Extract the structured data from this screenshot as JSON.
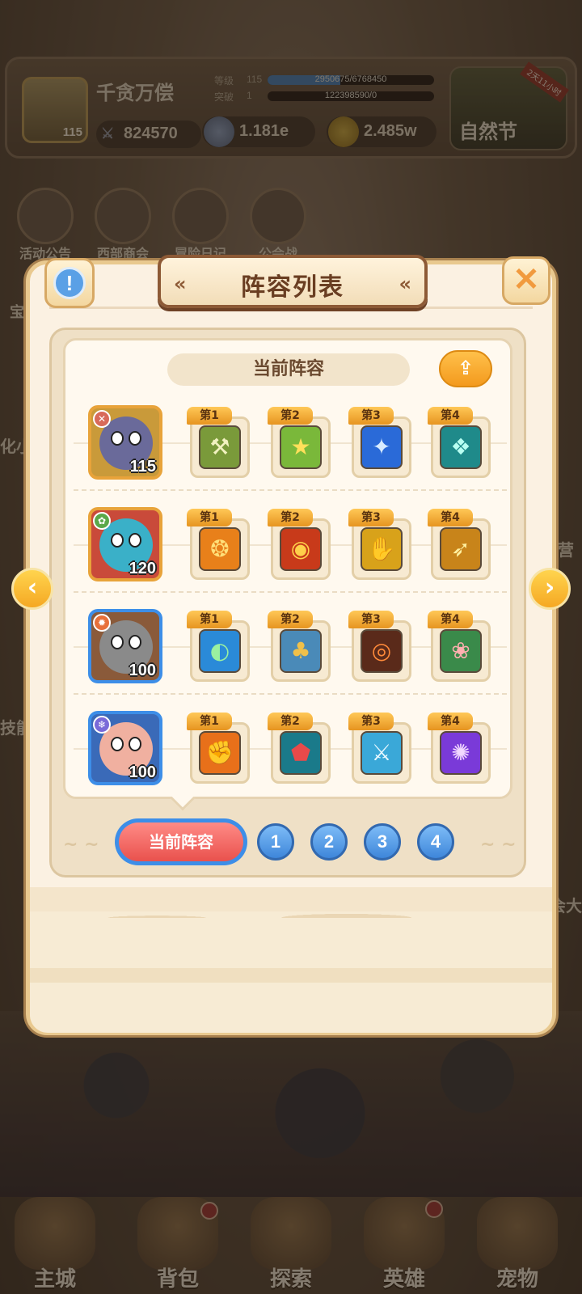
{
  "player": {
    "name": "千贪万偿",
    "avatar_level": "115",
    "power": "824570",
    "level_label": "等级",
    "level_value": "115",
    "level_progress": "2950675/6768450",
    "level_fraction": 0.436,
    "break_label": "突破",
    "break_value": "1",
    "break_progress": "122398590/0",
    "break_fraction": 0.0,
    "currency1": "1.181e",
    "currency2": "2.485w"
  },
  "festival": {
    "title": "自然节",
    "ribbon": "2天11小时"
  },
  "shortcuts": [
    {
      "label": "活动公告"
    },
    {
      "label": "西部商会"
    },
    {
      "label": "冒险日记"
    },
    {
      "label": "公会战"
    }
  ],
  "side_labels": {
    "left1": "宝",
    "left2": "化小",
    "left3": "技能",
    "right1": "营",
    "right2": "会大"
  },
  "modal": {
    "title": "阵容列表",
    "info_glyph": "!",
    "close_glyph": "✕",
    "current_header": "当前阵容",
    "share_glyph": "⇪",
    "rows": [
      {
        "level": "115",
        "border": "#e8a33a",
        "bg": "#c99a3a",
        "face": "#6a6a9a",
        "elem_color": "#d86a5a",
        "elem_glyph": "✕",
        "skills": [
          {
            "tag": "第1",
            "glyph": "⚒",
            "bg": "#7a9a3a",
            "fg": "#f2f2c0"
          },
          {
            "tag": "第2",
            "glyph": "★",
            "bg": "#7ab83a",
            "fg": "#ffe05a"
          },
          {
            "tag": "第3",
            "glyph": "✦",
            "bg": "#2a6ad8",
            "fg": "#d8ecff"
          },
          {
            "tag": "第4",
            "glyph": "❖",
            "bg": "#1f8a8a",
            "fg": "#b8fff2"
          }
        ]
      },
      {
        "level": "120",
        "border": "#e8a33a",
        "bg": "#c94a3a",
        "face": "#3ab0c8",
        "elem_color": "#5aa84a",
        "elem_glyph": "✿",
        "skills": [
          {
            "tag": "第1",
            "glyph": "❂",
            "bg": "#e8801a",
            "fg": "#ffe07a"
          },
          {
            "tag": "第2",
            "glyph": "◉",
            "bg": "#c83a1a",
            "fg": "#ffd04a"
          },
          {
            "tag": "第3",
            "glyph": "✋",
            "bg": "#d8a21a",
            "fg": "#fff2c0"
          },
          {
            "tag": "第4",
            "glyph": "➶",
            "bg": "#c8841a",
            "fg": "#fff0a0"
          }
        ]
      },
      {
        "level": "100",
        "border": "#3d8ee8",
        "bg": "#8a5a3a",
        "face": "#8a8a8a",
        "elem_color": "#e8703a",
        "elem_glyph": "✹",
        "skills": [
          {
            "tag": "第1",
            "glyph": "◐",
            "bg": "#2a8ad8",
            "fg": "#9af0a0"
          },
          {
            "tag": "第2",
            "glyph": "♣",
            "bg": "#4a8ab8",
            "fg": "#f0c04a"
          },
          {
            "tag": "第3",
            "glyph": "◎",
            "bg": "#5a2a1a",
            "fg": "#ff8a3a"
          },
          {
            "tag": "第4",
            "glyph": "❀",
            "bg": "#3a8a4a",
            "fg": "#ffb0b0"
          }
        ]
      },
      {
        "level": "100",
        "border": "#3d8ee8",
        "bg": "#3a6ab8",
        "face": "#f0b0a0",
        "elem_color": "#7a6ad8",
        "elem_glyph": "❄",
        "skills": [
          {
            "tag": "第1",
            "glyph": "✊",
            "bg": "#e8701a",
            "fg": "#ffe0a0"
          },
          {
            "tag": "第2",
            "glyph": "⬟",
            "bg": "#1a7a8a",
            "fg": "#e84a4a"
          },
          {
            "tag": "第3",
            "glyph": "⚔",
            "bg": "#3aa8d8",
            "fg": "#e8f8ff"
          },
          {
            "tag": "第4",
            "glyph": "✺",
            "bg": "#7a3ad8",
            "fg": "#f2d8ff"
          }
        ]
      }
    ],
    "tabs": {
      "current": "当前阵容",
      "numbers": [
        "1",
        "2",
        "3",
        "4"
      ]
    },
    "arrow_left_glyph": "‹",
    "arrow_right_glyph": "›"
  },
  "bottom_nav": [
    {
      "label": "主城"
    },
    {
      "label": "背包"
    },
    {
      "label": "探索"
    },
    {
      "label": "英雄"
    },
    {
      "label": "宠物"
    }
  ]
}
